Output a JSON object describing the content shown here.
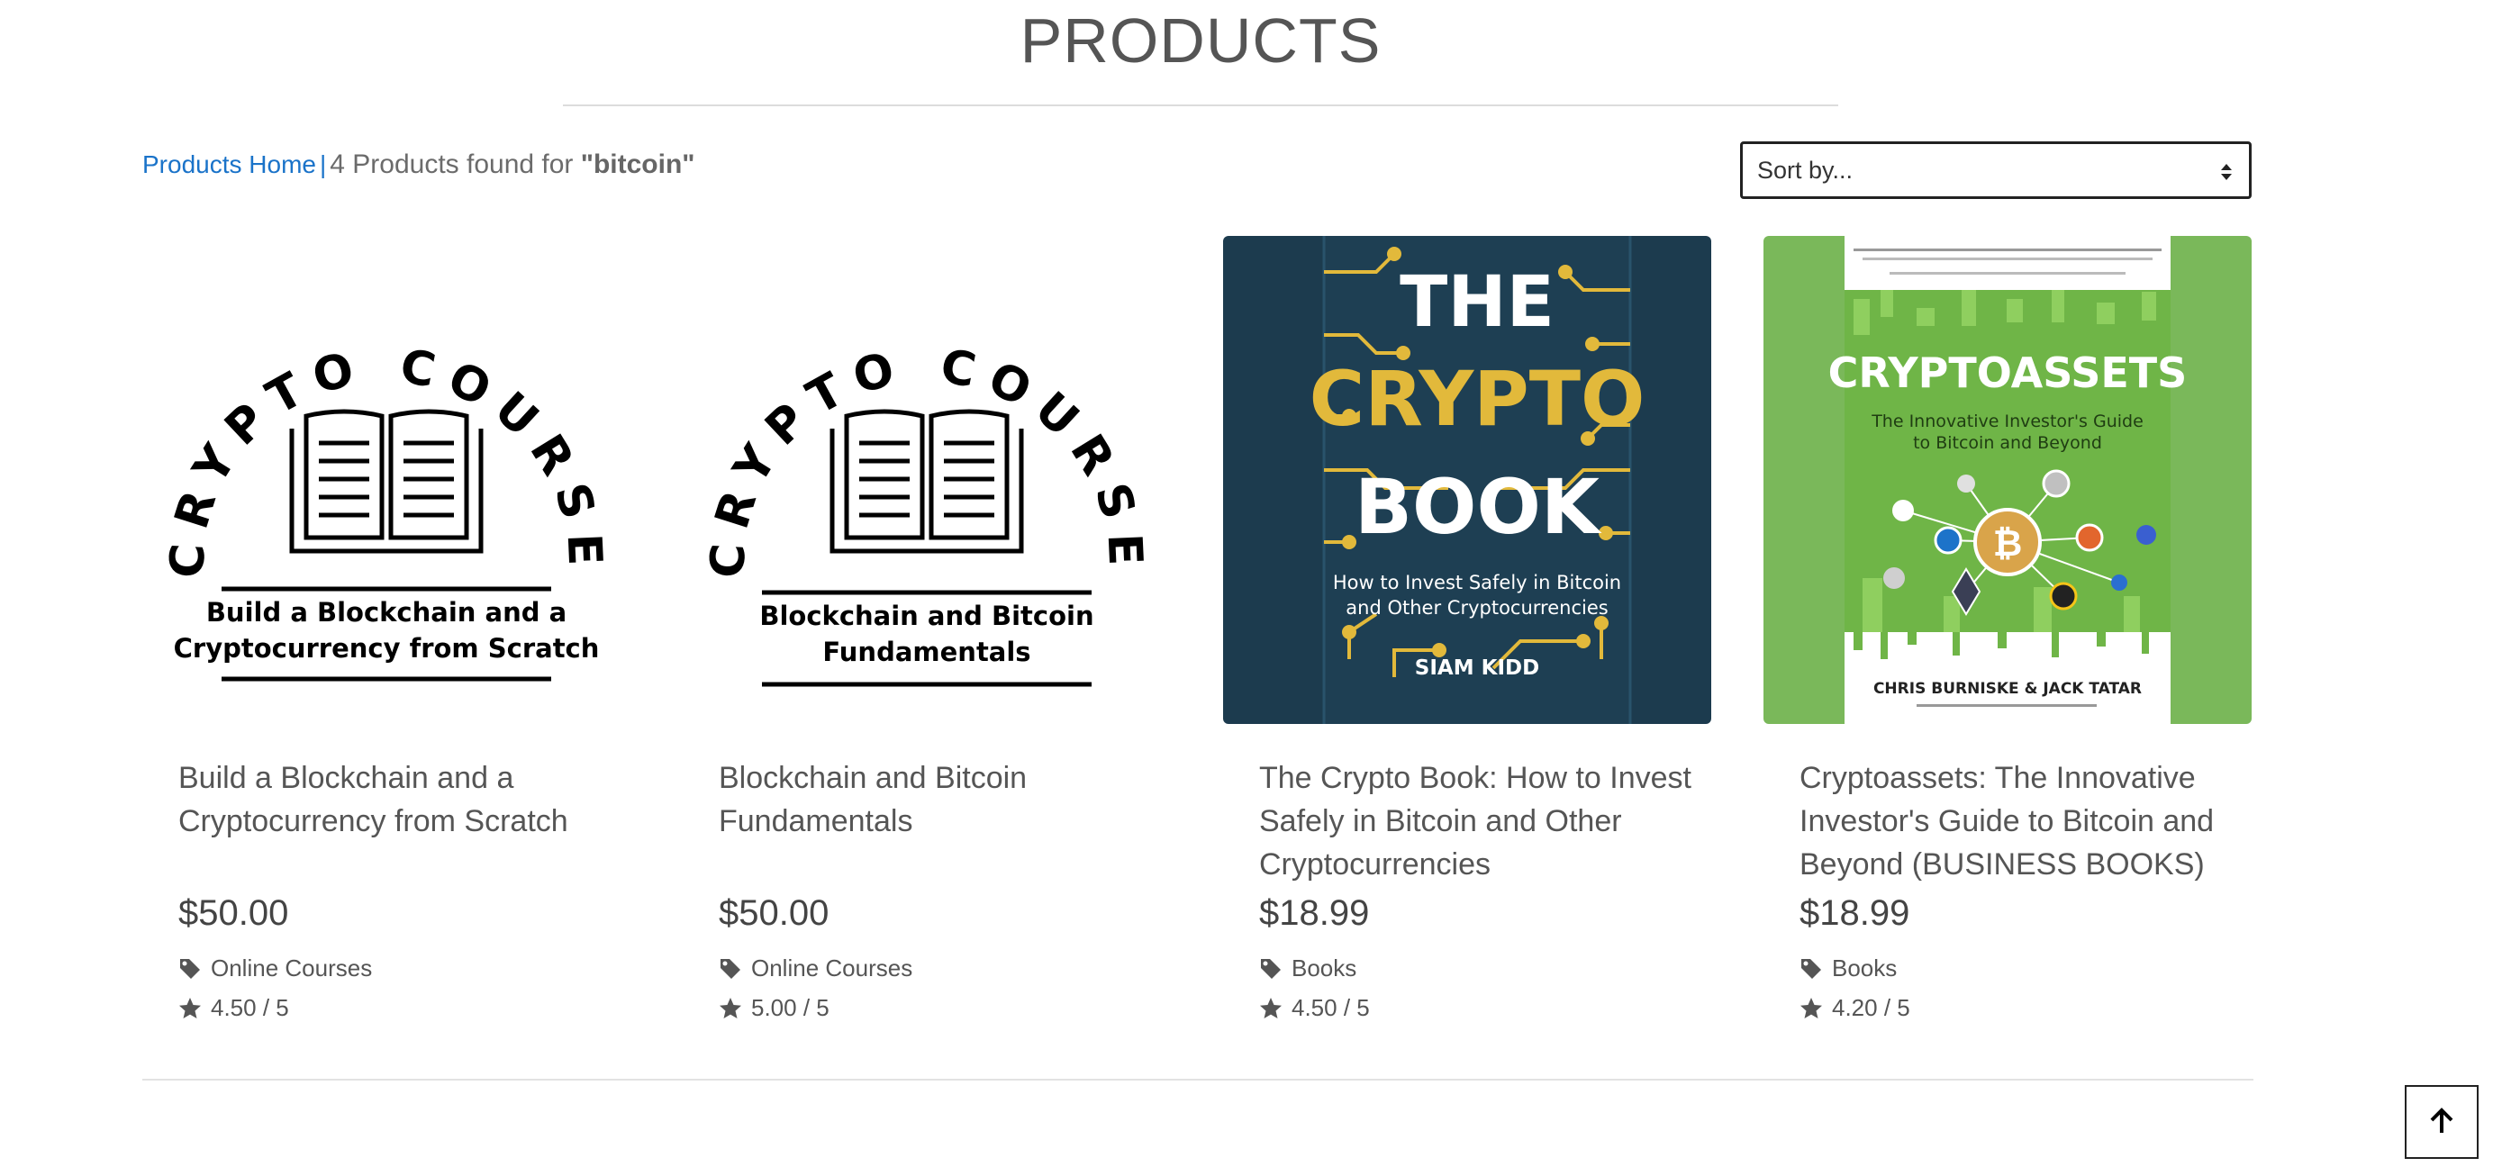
{
  "page": {
    "title": "PRODUCTS"
  },
  "results": {
    "home_link": "Products Home",
    "separator": "|",
    "count_text": "4 Products found for ",
    "query": "\"bitcoin\""
  },
  "sort": {
    "placeholder": "Sort by..."
  },
  "products": [
    {
      "name": "Build a Blockchain and a Cryptocurrency from Scratch",
      "price": "$50.00",
      "category": "Online Courses",
      "rating": "4.50 / 5",
      "image": {
        "arc_text": "CRYPTO COURSE",
        "line1": "Build a Blockchain and a",
        "line2": "Cryptocurrency from Scratch"
      }
    },
    {
      "name": "Blockchain and Bitcoin Fundamentals",
      "price": "$50.00",
      "category": "Online Courses",
      "rating": "5.00 / 5",
      "image": {
        "arc_text": "CRYPTO COURSE",
        "line1": "Blockchain and Bitcoin",
        "line2": "Fundamentals"
      }
    },
    {
      "name": "The Crypto Book: How to Invest Safely in Bitcoin and Other Cryptocurrencies",
      "price": "$18.99",
      "category": "Books",
      "rating": "4.50 / 5",
      "image": {
        "t1": "THE",
        "t2": "CRYPTO",
        "t3": "BOOK",
        "sub1": "How to Invest Safely in Bitcoin",
        "sub2": "and Other Cryptocurrencies",
        "author": "SIAM KIDD"
      }
    },
    {
      "name": "Cryptoassets: The Innovative Investor's Guide to Bitcoin and Beyond (BUSINESS BOOKS)",
      "price": "$18.99",
      "category": "Books",
      "rating": "4.20 / 5",
      "image": {
        "title": "CRYPTOASSETS",
        "sub1": "The Innovative Investor's Guide",
        "sub2": "to Bitcoin and Beyond",
        "authors": "CHRIS BURNISKE & JACK TATAR"
      }
    }
  ],
  "colors": {
    "link": "#1a73c9",
    "book1_bg": "#1c3b4e",
    "book1_gold": "#e2b93b",
    "book2_bg": "#7ab85a"
  },
  "icons": {
    "tag": "tag-icon",
    "star": "star-icon",
    "sort": "sort-arrows-icon",
    "scroll_top": "arrow-up-icon"
  }
}
